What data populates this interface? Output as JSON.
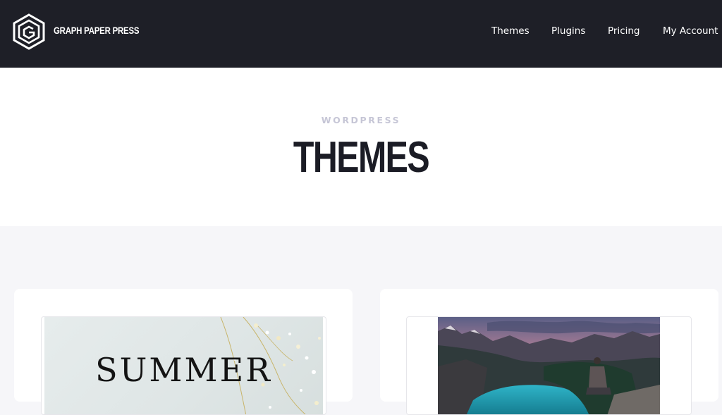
{
  "header": {
    "logo_text": "GRAPH PAPER PRESS",
    "nav": [
      {
        "label": "Themes"
      },
      {
        "label": "Plugins"
      },
      {
        "label": "Pricing"
      },
      {
        "label": "My Account"
      }
    ]
  },
  "hero": {
    "eyebrow": "WORDPRESS",
    "title": "THEMES"
  },
  "cards": [
    {
      "thumb_text": "SUMMER"
    },
    {
      "thumb_text": ""
    }
  ],
  "colors": {
    "header_bg": "#1e1f27",
    "page_bg": "#f6f6f9",
    "title": "#1b1c25",
    "eyebrow": "#c6c6d6"
  },
  "icons": [
    "logo-icon"
  ]
}
